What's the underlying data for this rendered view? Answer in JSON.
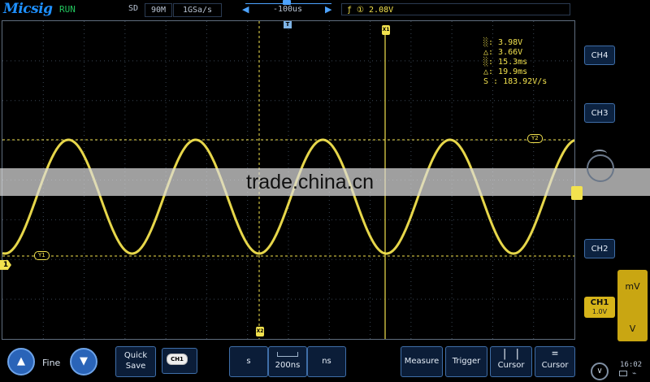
{
  "topbar": {
    "logo": "Micsig",
    "run_status": "RUN",
    "storage_mode": "SD",
    "memory_depth": "90M",
    "sample_rate": "1GSa/s",
    "trigger_left_arrow": "◀",
    "horizontal_position": "-100us",
    "trigger_right_arrow": "▶",
    "trigger_info": "ƒ ① 2.08V"
  },
  "measure": {
    "rows": [
      "░: 3.98V",
      "△: 3.66V",
      "░: 15.3ms",
      "△: 19.9ms",
      "S : 183.92V/s"
    ]
  },
  "markers": {
    "trigger_tag": "T",
    "x1": "X1",
    "x2": "X2",
    "y1": "Y1",
    "y2": "Y2",
    "ch1": "1"
  },
  "watermark": "trade.china.cn",
  "right_panel": {
    "ch4": "CH4",
    "ch3": "CH3",
    "ch2": "CH2",
    "ch1_label": "CH1",
    "ch1_scale": "1.0V",
    "unit_top": "mV",
    "unit_bottom": "V"
  },
  "bottom": {
    "up_icon": "▲",
    "fine_label": "Fine",
    "down_icon": "▼",
    "quick_save_line1": "Quick",
    "quick_save_line2": "Save",
    "ch1_chip": "CH1",
    "time_s": "s",
    "timebase": "200ns",
    "time_ns": "ns",
    "measure": "Measure",
    "trigger": "Trigger",
    "cursor1": "Cursor",
    "cursor2": "Cursor",
    "clock": "16:02",
    "chevron": "∨"
  },
  "colors": {
    "trace": "#f2e24e",
    "accent": "#3f6ea8",
    "panel_bg": "#0b1d38"
  }
}
